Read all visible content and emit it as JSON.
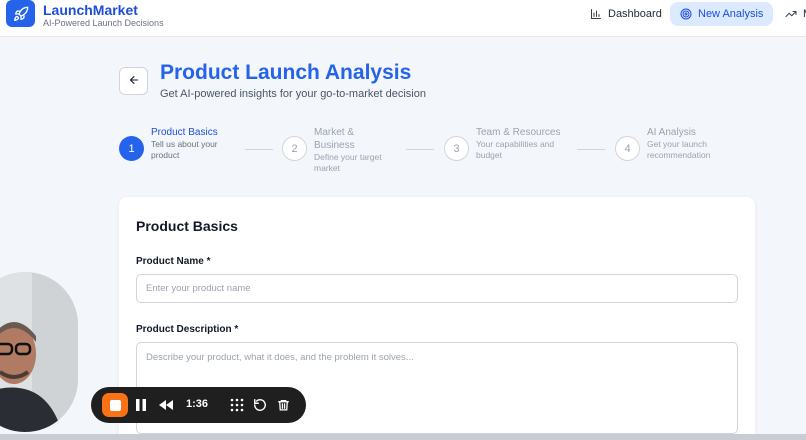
{
  "brand": {
    "name": "LaunchMarket",
    "tagline": "AI-Powered Launch Decisions"
  },
  "nav": {
    "dashboard": "Dashboard",
    "new_analysis": "New Analysis",
    "truncated": "M"
  },
  "header": {
    "title": "Product Launch Analysis",
    "subtitle": "Get AI-powered insights for your go-to-market decision"
  },
  "steps": [
    {
      "number": "1",
      "title": "Product Basics",
      "desc": "Tell us about your product"
    },
    {
      "number": "2",
      "title": "Market & Business",
      "desc": "Define your target market"
    },
    {
      "number": "3",
      "title": "Team & Resources",
      "desc": "Your capabilities and budget"
    },
    {
      "number": "4",
      "title": "AI Analysis",
      "desc": "Get your launch recommendation"
    }
  ],
  "form": {
    "section_title": "Product Basics",
    "name_label": "Product Name *",
    "name_placeholder": "Enter your product name",
    "desc_label": "Product Description *",
    "desc_placeholder": "Describe your product, what it does, and the problem it solves..."
  },
  "recorder": {
    "time": "1:36"
  },
  "colors": {
    "primary": "#2563eb",
    "active_nav_bg": "#dbeafe",
    "record_stop": "#f97316"
  },
  "icons": [
    "rocket-icon",
    "bar-chart-icon",
    "target-icon",
    "trending-up-icon",
    "arrow-left-icon",
    "stop-icon",
    "pause-icon",
    "rewind-icon",
    "grid-icon",
    "restart-icon",
    "trash-icon"
  ]
}
